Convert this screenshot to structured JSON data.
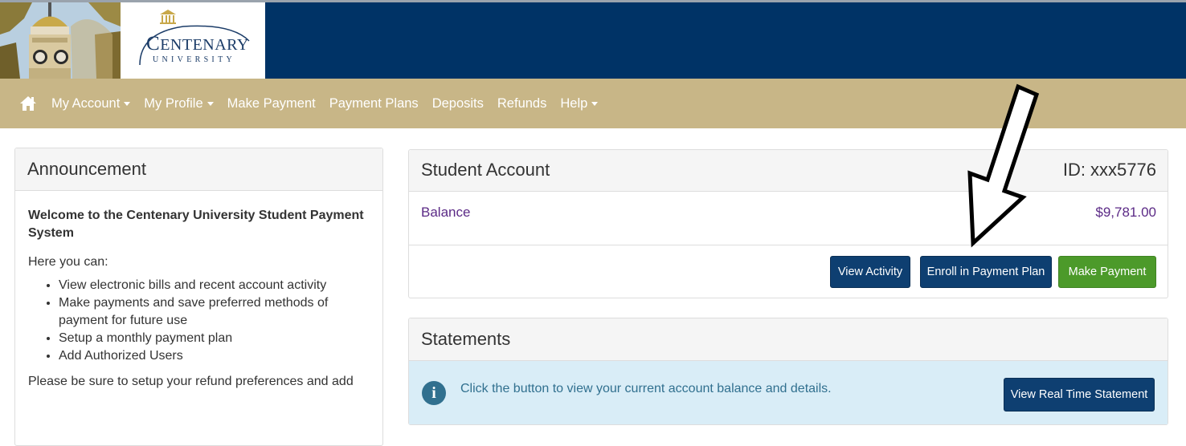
{
  "header": {
    "logo_name_first": "C",
    "logo_name_rest": "ENTENARY",
    "logo_sub": "UNIVERSITY"
  },
  "nav": {
    "home_icon": "home-icon",
    "items": [
      {
        "label": "My Account",
        "dropdown": true
      },
      {
        "label": "My Profile",
        "dropdown": true
      },
      {
        "label": "Make Payment",
        "dropdown": false
      },
      {
        "label": "Payment Plans",
        "dropdown": false
      },
      {
        "label": "Deposits",
        "dropdown": false
      },
      {
        "label": "Refunds",
        "dropdown": false
      },
      {
        "label": "Help",
        "dropdown": true
      }
    ]
  },
  "announcement": {
    "heading": "Announcement",
    "title": "Welcome to the Centenary University Student Payment System",
    "intro": "Here you can:",
    "bullets": [
      "View electronic bills and recent account activity",
      "Make payments and save preferred methods of payment for future use",
      "Setup a monthly payment plan",
      "Add Authorized Users"
    ],
    "note": "Please be sure to setup your refund preferences and add"
  },
  "account": {
    "heading": "Student Account",
    "id": "ID: xxx5776",
    "balance_label": "Balance",
    "balance_amount": "$9,781.00",
    "view_activity": "View Activity",
    "enroll_plan": "Enroll in Payment Plan",
    "make_payment": "Make Payment"
  },
  "statements": {
    "heading": "Statements",
    "info_icon": "info-icon",
    "info_text": "Click the button to view your current account balance and details.",
    "view_statement": "View Real Time Statement"
  },
  "colors": {
    "banner": "#003366",
    "nav": "#c8b687",
    "navy_button": "#0e3f71",
    "green_button": "#4c9a2a",
    "info_bg": "#d9edf7",
    "balance_text": "#5b2a86"
  }
}
